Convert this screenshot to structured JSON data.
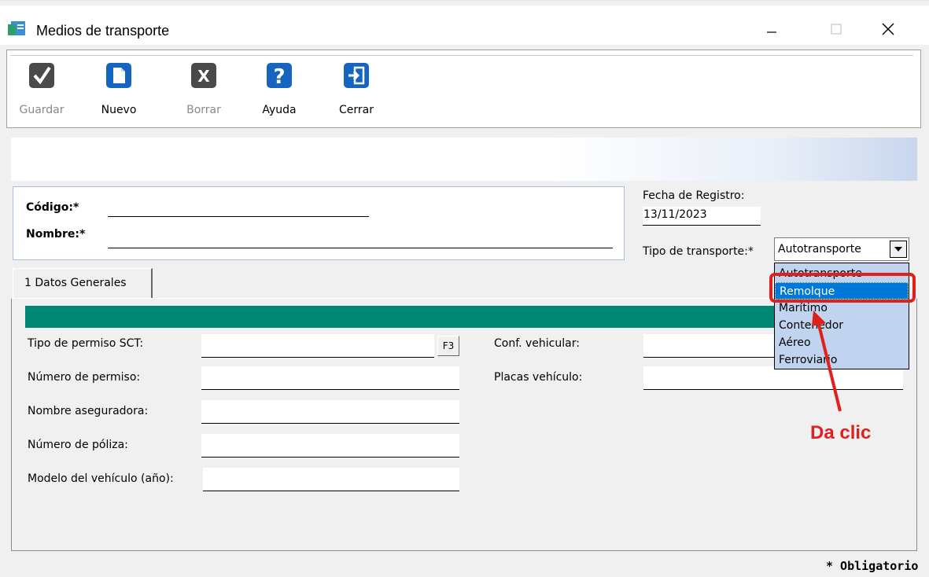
{
  "window": {
    "title": "Medios de transporte",
    "app_icon": "app-icon",
    "controls": [
      "minimize-icon",
      "maximize-icon",
      "close-icon"
    ]
  },
  "toolbar": {
    "buttons": [
      {
        "label": "Guardar",
        "icon": "check-icon",
        "enabled": false
      },
      {
        "label": "Nuevo",
        "icon": "new-document-icon",
        "enabled": true
      },
      {
        "label": "Borrar",
        "icon": "delete-x-icon",
        "enabled": false
      },
      {
        "label": "Ayuda",
        "icon": "help-icon",
        "enabled": true
      },
      {
        "label": "Cerrar",
        "icon": "exit-door-icon",
        "enabled": true
      }
    ]
  },
  "header_form": {
    "codigo_label": "Código:*",
    "codigo_value": "",
    "nombre_label": "Nombre:*",
    "nombre_value": "",
    "fecha_label": "Fecha de Registro:",
    "fecha_value": "13/11/2023",
    "tipo_label": "Tipo de transporte:*",
    "tipo_value": "Autotransporte"
  },
  "dropdown": {
    "options": [
      "Autotransporte",
      "Remolque",
      "Marítimo",
      "Contenedor",
      "Aéreo",
      "Ferroviario"
    ],
    "highlighted": "Remolque"
  },
  "tabs": [
    {
      "label": "1 Datos Generales"
    }
  ],
  "datos_generales": {
    "left_fields": [
      {
        "label": "Tipo de permiso SCT:",
        "value": "",
        "button": "F3"
      },
      {
        "label": "Número de permiso:",
        "value": ""
      },
      {
        "label": "Nombre aseguradora:",
        "value": ""
      },
      {
        "label": "Número de póliza:",
        "value": ""
      },
      {
        "label": "Modelo del vehículo (año):",
        "value": ""
      }
    ],
    "right_fields": [
      {
        "label": "Conf. vehicular:",
        "value": ""
      },
      {
        "label": "Placas vehículo:",
        "value": ""
      }
    ]
  },
  "annotation": {
    "callout": "Da clic",
    "color": "#e0201c"
  },
  "footer": {
    "required_note": "* Obligatorio"
  },
  "colors": {
    "teal_bar": "#008877",
    "selection": "#0078d7",
    "dropdown_bg": "#c0d4ef"
  }
}
